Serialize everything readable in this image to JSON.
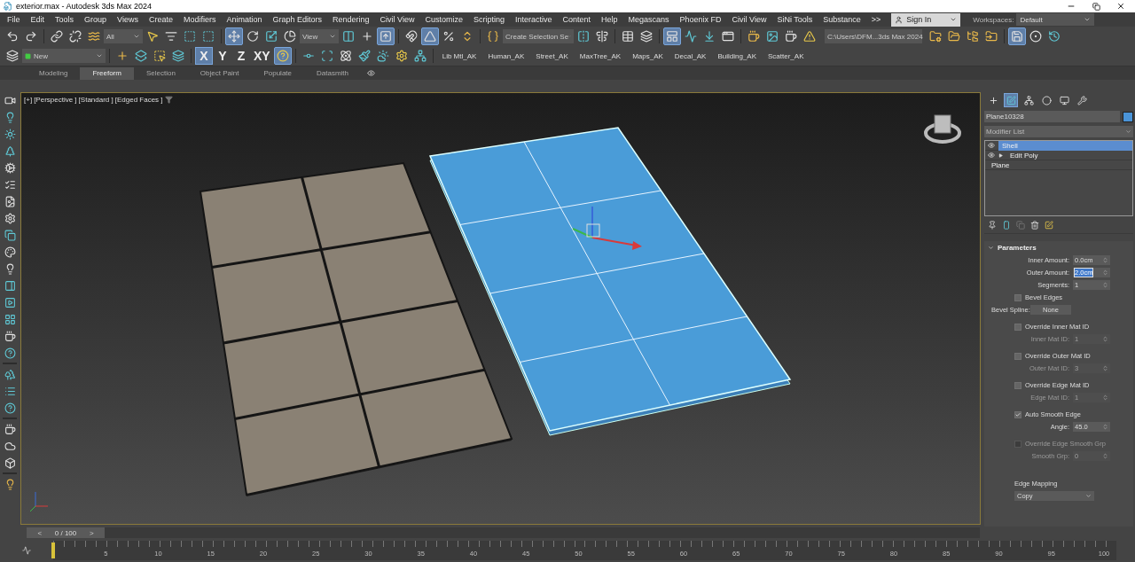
{
  "window": {
    "title": "exterior.max - Autodesk 3ds Max 2024"
  },
  "menu": [
    "File",
    "Edit",
    "Tools",
    "Group",
    "Views",
    "Create",
    "Modifiers",
    "Animation",
    "Graph Editors",
    "Rendering",
    "Civil View",
    "Customize",
    "Scripting",
    "Interactive",
    "Content",
    "Help",
    "Megascans",
    "Phoenix FD",
    "Civil View",
    "SiNi Tools",
    "Substance",
    ">>"
  ],
  "account": {
    "sign_in": "Sign In",
    "workspaces_label": "Workspaces:",
    "workspace": "Default"
  },
  "main_toolbar": {
    "selection_filter": "All",
    "reference_coordinate": "View",
    "named_selection": "Create Selection Se",
    "project_path": "C:\\Users\\DFM...3ds Max 2024",
    "tools": [
      {
        "active": false
      },
      {
        "active": false
      },
      {
        "active": false
      },
      {
        "active": false
      },
      {
        "active": false
      },
      {
        "active": false
      },
      {
        "active": false
      },
      {
        "active": false
      },
      {
        "active": false
      },
      {
        "active": true
      },
      {
        "active": false
      },
      {
        "active": false
      },
      {
        "active": false
      },
      {
        "active": false
      },
      {
        "active": false
      },
      {
        "active": true
      },
      {
        "active": false
      },
      {
        "active": true
      },
      {
        "active": false
      },
      {
        "active": false
      },
      {
        "active": false
      },
      {
        "active": false
      },
      {
        "active": false
      },
      {
        "active": false
      },
      {
        "active": false
      },
      {
        "active": true
      },
      {
        "active": false
      },
      {
        "active": false
      },
      {
        "active": false
      },
      {
        "active": false
      },
      {
        "active": false
      },
      {
        "active": false
      },
      {
        "active": false
      },
      {
        "active": false
      },
      {
        "active": false
      },
      {
        "active": false
      },
      {
        "active": false
      },
      {
        "active": true
      },
      {
        "active": false
      },
      {
        "active": false
      }
    ]
  },
  "second_toolbar": {
    "layer": "New",
    "axes": [
      {
        "label": "X",
        "active": true
      },
      {
        "label": "Y",
        "active": false
      },
      {
        "label": "Z",
        "active": false
      },
      {
        "label": "XY",
        "active": false
      }
    ],
    "scripts": [
      "Lib Mtl_AK",
      "Human_AK",
      "Street_AK",
      "MaxTree_AK",
      "Maps_AK",
      "Decal_AK",
      "Building_AK",
      "Scatter_AK"
    ]
  },
  "ribbon_tabs": [
    {
      "label": "Modeling",
      "selected": false
    },
    {
      "label": "Freeform",
      "selected": true
    },
    {
      "label": "Selection",
      "selected": false
    },
    {
      "label": "Object Paint",
      "selected": false
    },
    {
      "label": "Populate",
      "selected": false
    },
    {
      "label": "Datasmith",
      "selected": false
    }
  ],
  "viewport": {
    "labels": [
      "[+]",
      "[Perspective ]",
      "[Standard ]",
      "[Edged Faces ]"
    ]
  },
  "command_panel": {
    "tabs": [
      {
        "selected": false
      },
      {
        "selected": true
      },
      {
        "selected": false
      },
      {
        "selected": false
      },
      {
        "selected": false
      },
      {
        "selected": false
      }
    ],
    "object_name": "Plane10328",
    "modifier_list": "Modifier List",
    "stack": [
      {
        "label": "Shell",
        "selected": true,
        "visible": true,
        "expandable": false
      },
      {
        "label": "Edit Poly",
        "selected": false,
        "visible": true,
        "expandable": true
      },
      {
        "label": "Plane",
        "selected": false,
        "visible": false,
        "expandable": false
      }
    ],
    "rollout": {
      "title": "Parameters",
      "expanded": true,
      "rows": [
        {
          "kind": "spinner",
          "label": "Inner Amount:",
          "value": "0.0cm",
          "disabled": false,
          "focused": false
        },
        {
          "kind": "spinner",
          "label": "Outer Amount:",
          "value": "2.0cm",
          "disabled": false,
          "focused": true
        },
        {
          "kind": "spinner",
          "label": "Segments:",
          "value": "1",
          "disabled": false,
          "focused": false
        },
        {
          "kind": "checkbox",
          "label": "Bevel Edges",
          "checked": false,
          "disabled": false
        },
        {
          "kind": "button",
          "label": "Bevel Spline:",
          "value": "None"
        },
        {
          "kind": "checkbox",
          "label": "Override Inner Mat ID",
          "checked": false,
          "disabled": false
        },
        {
          "kind": "spinner",
          "label": "Inner Mat ID:",
          "value": "1",
          "disabled": true,
          "focused": false
        },
        {
          "kind": "checkbox",
          "label": "Override Outer Mat ID",
          "checked": false,
          "disabled": false
        },
        {
          "kind": "spinner",
          "label": "Outer Mat ID:",
          "value": "3",
          "disabled": true,
          "focused": false
        },
        {
          "kind": "checkbox",
          "label": "Override Edge Mat ID",
          "checked": false,
          "disabled": false
        },
        {
          "kind": "spinner",
          "label": "Edge Mat ID:",
          "value": "1",
          "disabled": true,
          "focused": false
        },
        {
          "kind": "checkbox",
          "label": "Auto Smooth Edge",
          "checked": true,
          "disabled": false
        },
        {
          "kind": "spinner",
          "label": "Angle:",
          "value": "45.0",
          "disabled": false,
          "focused": false
        },
        {
          "kind": "checkbox",
          "label": "Override Edge Smooth Grp",
          "checked": false,
          "disabled": true
        },
        {
          "kind": "spinner",
          "label": "Smooth Grp:",
          "value": "0",
          "disabled": true,
          "focused": false
        },
        {
          "kind": "heading",
          "label": "Edge Mapping"
        },
        {
          "kind": "dropdown",
          "value": "Copy"
        }
      ]
    }
  },
  "time_slider": {
    "prev": "<",
    "frame": "0 / 100",
    "next": ">"
  },
  "track_bar": {
    "labels": [
      "5",
      "10",
      "15",
      "20",
      "25",
      "30",
      "35",
      "40",
      "45",
      "50",
      "55",
      "60",
      "65",
      "70",
      "75",
      "80",
      "85",
      "90",
      "95",
      "100"
    ]
  }
}
